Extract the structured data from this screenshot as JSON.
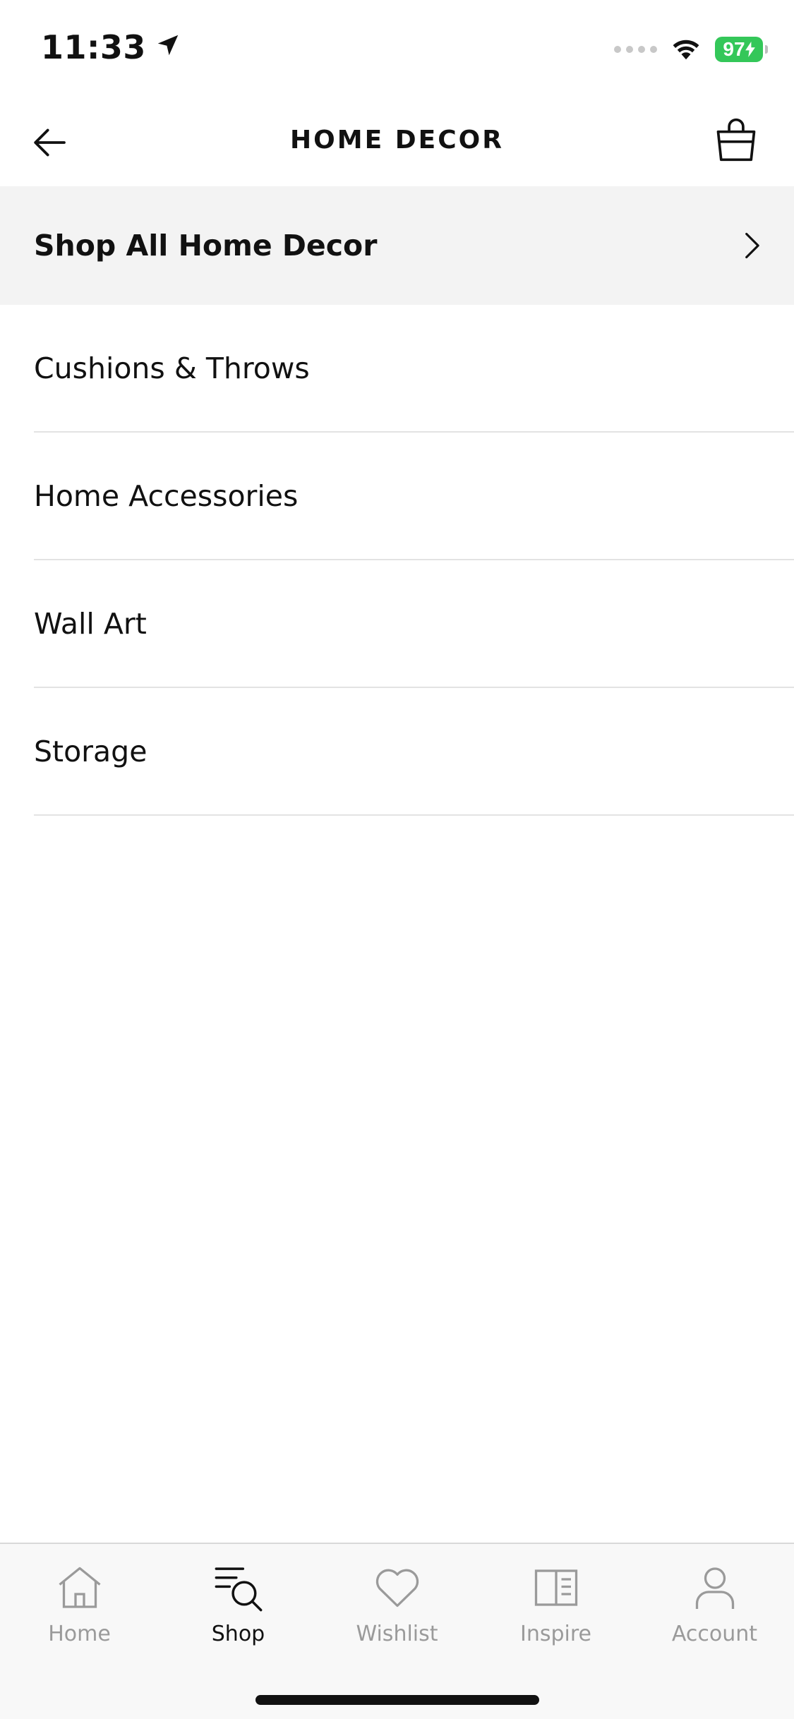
{
  "status_bar": {
    "time": "11:33",
    "battery": "97"
  },
  "nav": {
    "title": "HOME DECOR"
  },
  "shop_all": {
    "label": "Shop All Home Decor"
  },
  "categories": [
    {
      "label": "Cushions & Throws"
    },
    {
      "label": "Home Accessories"
    },
    {
      "label": "Wall Art"
    },
    {
      "label": "Storage"
    }
  ],
  "tab_bar": {
    "tabs": [
      {
        "label": "Home",
        "icon": "home-icon",
        "active": false
      },
      {
        "label": "Shop",
        "icon": "shop-search-icon",
        "active": true
      },
      {
        "label": "Wishlist",
        "icon": "heart-icon",
        "active": false
      },
      {
        "label": "Inspire",
        "icon": "book-icon",
        "active": false
      },
      {
        "label": "Account",
        "icon": "user-icon",
        "active": false
      }
    ]
  },
  "colors": {
    "battery": "#34c759",
    "active_tab": "#111111",
    "inactive_tab": "#9a9a9a",
    "shop_all_bg": "#f3f3f3"
  }
}
